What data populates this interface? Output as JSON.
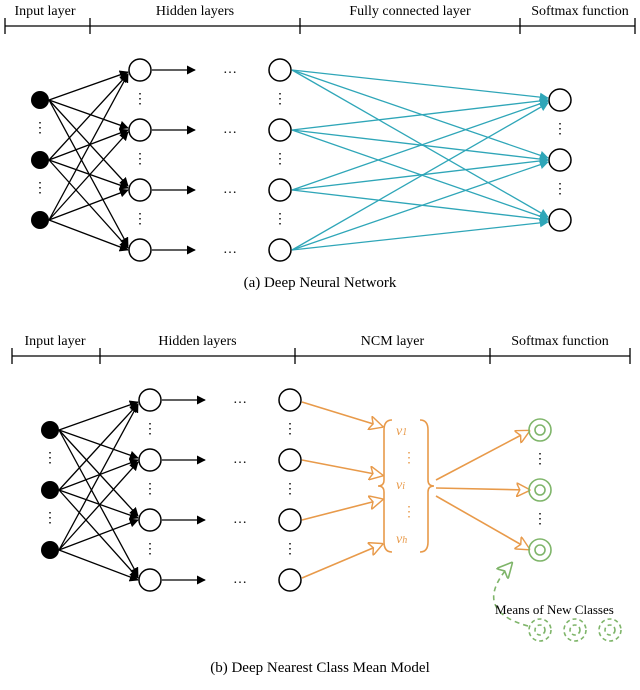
{
  "top": {
    "headers": {
      "input": "Input layer",
      "hidden": "Hidden layers",
      "fc": "Fully connected layer",
      "softmax": "Softmax function"
    },
    "caption": "(a) Deep Neural Network"
  },
  "bottom": {
    "headers": {
      "input": "Input layer",
      "hidden": "Hidden layers",
      "ncm": "NCM layer",
      "softmax": "Softmax function"
    },
    "vector_labels": {
      "v1": "v",
      "v1_sub": "1",
      "vi": "v",
      "vi_sub": "i",
      "vh": "v",
      "vh_sub": "h"
    },
    "means_label": "Means of New Classes",
    "caption": "(b) Deep Nearest Class Mean Model"
  },
  "chart_data": {
    "type": "diagram",
    "subfigures": [
      {
        "id": "a",
        "title": "Deep Neural Network",
        "layers": [
          {
            "name": "Input layer",
            "nodes": 3,
            "style": "filled-black",
            "ellipsis_between": true
          },
          {
            "name": "Hidden layer 1",
            "nodes": 4,
            "style": "hollow",
            "ellipsis_between": true
          },
          {
            "name": "Hidden layer 2",
            "nodes": 4,
            "style": "hollow",
            "ellipsis_between": true
          },
          {
            "name": "Output",
            "nodes": 3,
            "style": "hollow",
            "ellipsis_between": true
          }
        ],
        "connections": [
          {
            "from": "Input layer",
            "to": "Hidden layer 1",
            "type": "fully-connected",
            "color": "black",
            "arrows": true
          },
          {
            "from": "Hidden layer 1",
            "to": "Hidden layer 2",
            "type": "one-to-one-with-ellipsis",
            "color": "black",
            "arrows": true
          },
          {
            "from": "Hidden layer 2",
            "to": "Output",
            "type": "fully-connected",
            "color": "teal",
            "arrows": true,
            "note": "Fully connected layer -> Softmax function"
          }
        ]
      },
      {
        "id": "b",
        "title": "Deep Nearest Class Mean Model",
        "layers": [
          {
            "name": "Input layer",
            "nodes": 3,
            "style": "filled-black",
            "ellipsis_between": true
          },
          {
            "name": "Hidden layer 1",
            "nodes": 4,
            "style": "hollow",
            "ellipsis_between": true
          },
          {
            "name": "Hidden layer 2",
            "nodes": 4,
            "style": "hollow",
            "ellipsis_between": true
          },
          {
            "name": "NCM vector v",
            "components": [
              "v_1",
              "...",
              "v_i",
              "...",
              "v_h"
            ],
            "color": "orange"
          },
          {
            "name": "Class means (output)",
            "nodes": 3,
            "style": "double-ring-green",
            "ellipsis_between": true
          }
        ],
        "connections": [
          {
            "from": "Input layer",
            "to": "Hidden layer 1",
            "type": "fully-connected",
            "color": "black",
            "arrows": true
          },
          {
            "from": "Hidden layer 1",
            "to": "Hidden layer 2",
            "type": "one-to-one-with-ellipsis",
            "color": "black",
            "arrows": true
          },
          {
            "from": "Hidden layer 2",
            "to": "NCM vector v",
            "type": "many-to-one",
            "color": "orange",
            "arrows": true
          },
          {
            "from": "NCM vector v",
            "to": "Class means (output)",
            "type": "one-to-many",
            "color": "orange",
            "arrows": true
          }
        ],
        "extra": {
          "means_of_new_classes": {
            "count": 3,
            "style": "dashed-green-circles",
            "arrow_to": "Class means (output)",
            "label": "Means of New Classes"
          }
        }
      }
    ]
  }
}
